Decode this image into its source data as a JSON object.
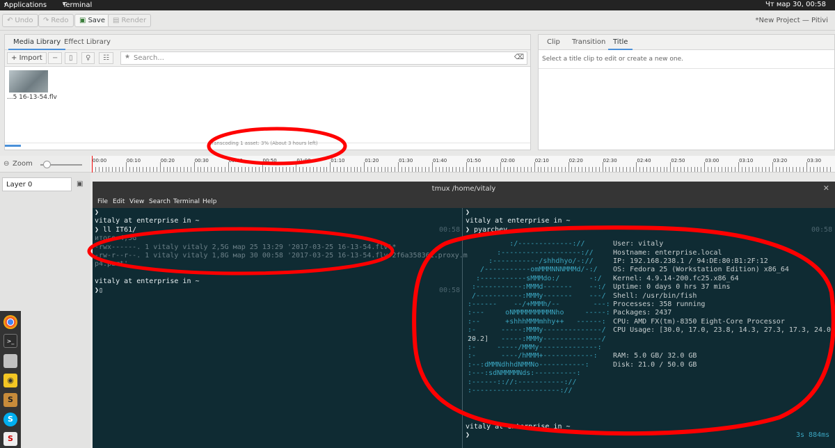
{
  "topbar": {
    "applications": "Applications",
    "terminal": "Terminal",
    "clock": "Чт мар 30, 00:58"
  },
  "toolbar": {
    "undo": "Undo",
    "redo": "Redo",
    "save": "Save",
    "render": "Render",
    "project_title": "*New Project — Pitivi"
  },
  "library": {
    "tabs": [
      "Media Library",
      "Effect Library"
    ],
    "import": "Import",
    "search_placeholder": "Search...",
    "clip_label": "...5 16-13-54.flv",
    "transcoding": "Transcoding 1 asset: 3% (About 3 hours left)",
    "progress": 0.03
  },
  "clip_panel": {
    "tabs": [
      "Clip",
      "Transition",
      "Title"
    ],
    "message": "Select a title clip to edit or create a new one."
  },
  "timeline": {
    "zoom_label": "Zoom",
    "layer": "Layer 0",
    "ticks": [
      "00:00",
      "00:10",
      "00:20",
      "00:30",
      "00:40",
      "00:50",
      "01:00",
      "01:10",
      "01:20",
      "01:30",
      "01:40",
      "01:50",
      "02:00",
      "02:10",
      "02:20",
      "02:30",
      "02:40",
      "02:50",
      "03:00",
      "03:10",
      "03:20",
      "03:30"
    ]
  },
  "terminal": {
    "title": "tmux /home/vitaly",
    "menu": [
      "File",
      "Edit",
      "View",
      "Search",
      "Terminal",
      "Help"
    ],
    "left": [
      {
        "t": "❯",
        "ts": ""
      },
      {
        "t": "vitaly at enterprise in ~",
        "ts": ""
      },
      {
        "t": "❯ ll IT61/",
        "ts": "00:58"
      },
      {
        "t": "итого 4,3G",
        "ts": ""
      },
      {
        "t": "-rwx------. 1 vitaly vitaly 2,5G мар 25 13:29 '2017-03-25 16-13-54.flv'*",
        "ts": ""
      },
      {
        "t": "-rw-r--r--. 1 vitaly vitaly 1,8G мар 30 00:58 '2017-03-25 16-13-54.flv.2f6a358361.proxy.m",
        "ts": ""
      },
      {
        "t": "p4.part'",
        "ts": ""
      },
      {
        "t": "",
        "ts": ""
      },
      {
        "t": "vitaly at enterprise in ~",
        "ts": ""
      },
      {
        "t": "❯▯",
        "ts": "00:58"
      }
    ],
    "right_header": [
      {
        "t": "❯",
        "ts": ""
      },
      {
        "t": "vitaly at enterprise in ~",
        "ts": ""
      },
      {
        "t": "❯ pyarchey",
        "ts": "00:58"
      }
    ],
    "logo": [
      "          :/-------------://",
      "       :-------------------://",
      "     :-----------/shhdhyo/-://",
      "   /-----------omMMMNNNMMMd/-:/",
      "  :-----------sMMMdo:/       -:/",
      " :-----------:MMMd-------    --:/",
      " /-----------:MMMy-------    ---/",
      ":------    --/+MMMh/--        ---:",
      ":---     oNMMMMMMMMMNho     -----:",
      ":--      +shhhMMMmhhy++   ------:",
      ":-      -----:MMMy--------------/",
      ":-      -----:MMMy--------------/",
      ":-     -----/MMMy--------------:",
      ":-      ----/hMMM+------------:",
      ":--:dMMNdhhdNMMNo-----------:",
      ":---:sdNMMMMNds:----------:",
      ":------:://:-----------://",
      ":---------------------://"
    ],
    "info": [
      "User: vitaly",
      "Hostname: enterprise.local",
      "IP: 192.168.238.1 / 94:DE:80:B1:2F:12",
      "OS: Fedora 25 (Workstation Edition) x86_64",
      "Kernel: 4.9.14-200.fc25.x86_64",
      "Uptime: 0 days 0 hrs 37 mins",
      "Shell: /usr/bin/fish",
      "Processes: 358 running",
      "Packages: 2437",
      "CPU: AMD FX(tm)-8350 Eight-Core Processor",
      "CPU Usage: [30.0, 17.0, 23.8, 14.3, 27.3, 17.3, 24.0,",
      "20.2]",
      "",
      "RAM: 5.0 GB/ 32.0 GB",
      "Disk: 21.0 / 50.0 GB"
    ],
    "right_footer": "vitaly at enterprise in ~",
    "right_prompt": "❯",
    "elapsed": "3s 884ms"
  },
  "colors": {
    "annotation": "#ff0000",
    "terminal_bg": "#0f2b33",
    "accent": "#4a90d9"
  }
}
